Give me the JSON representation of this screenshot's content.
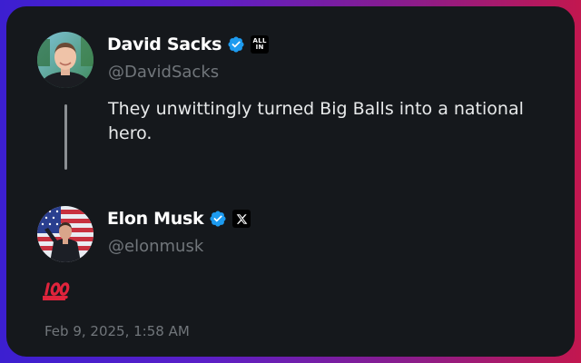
{
  "tweet": {
    "author": {
      "name": "David Sacks",
      "handle": "@DavidSacks",
      "affiliation": "ALL IN",
      "verified_color": "#1d9bf0"
    },
    "text": "They unwittingly turned Big Balls into a national hero."
  },
  "reply": {
    "author": {
      "name": "Elon Musk",
      "handle": "@elonmusk",
      "affiliation_icon": "x-logo-icon",
      "verified_color": "#1d9bf0"
    },
    "content_emoji": "💯",
    "content_emoji_icon": "hundred-points-icon",
    "timestamp": "Feb 9, 2025, 1:58 AM"
  },
  "colors": {
    "card_background": "#15181c",
    "primary_text": "#e7e9ea",
    "secondary_text": "#71767b",
    "accent": "#1d9bf0"
  }
}
